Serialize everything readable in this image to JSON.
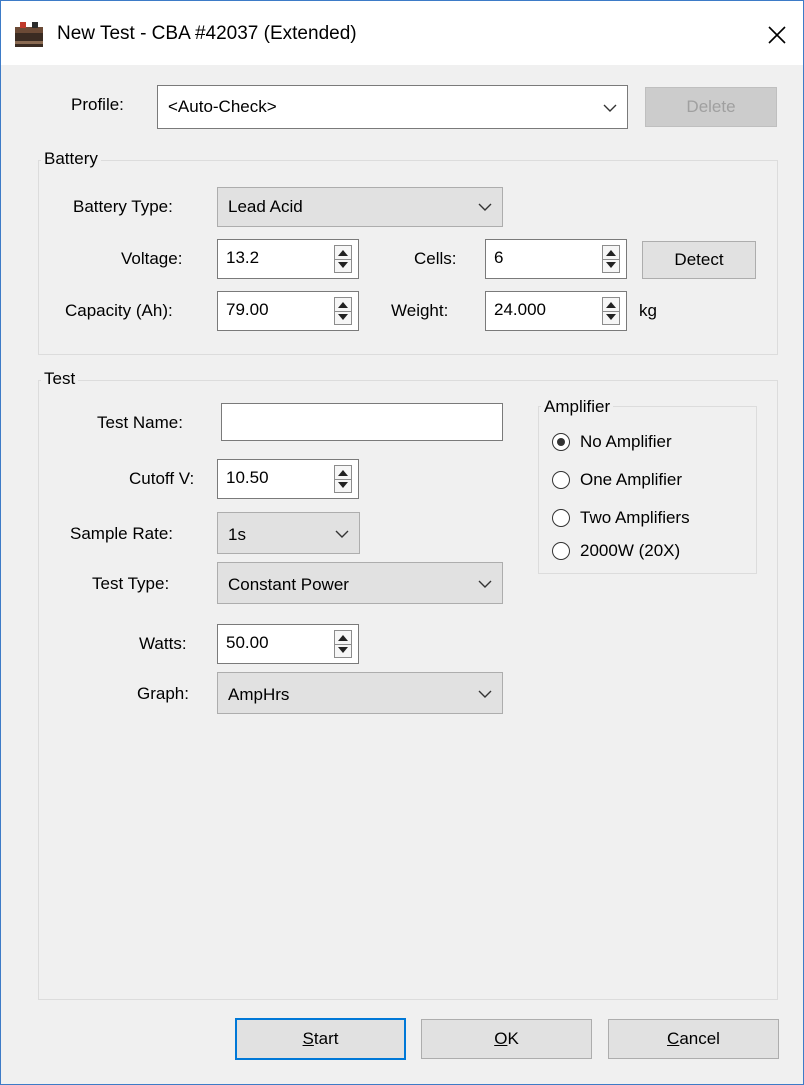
{
  "window": {
    "title": "New Test - CBA #42037 (Extended)"
  },
  "profile": {
    "label": "Profile:",
    "value": "<Auto-Check>",
    "delete_label": "Delete"
  },
  "battery": {
    "group_label": "Battery",
    "type_label": "Battery Type:",
    "type_value": "Lead Acid",
    "voltage_label": "Voltage:",
    "voltage_value": "13.2",
    "cells_label": "Cells:",
    "cells_value": "6",
    "detect_label": "Detect",
    "capacity_label": "Capacity (Ah):",
    "capacity_value": "79.00",
    "weight_label": "Weight:",
    "weight_value": "24.000",
    "weight_unit": "kg"
  },
  "test": {
    "group_label": "Test",
    "name_label": "Test Name:",
    "name_value": "",
    "cutoff_label": "Cutoff V:",
    "cutoff_value": "10.50",
    "sample_rate_label": "Sample Rate:",
    "sample_rate_value": "1s",
    "test_type_label": "Test Type:",
    "test_type_value": "Constant Power",
    "watts_label": "Watts:",
    "watts_value": "50.00",
    "graph_label": "Graph:",
    "graph_value": "AmpHrs"
  },
  "amplifier": {
    "group_label": "Amplifier",
    "options": [
      {
        "label": "No Amplifier",
        "selected": true
      },
      {
        "label": "One Amplifier",
        "selected": false
      },
      {
        "label": "Two Amplifiers",
        "selected": false
      },
      {
        "label": "2000W (20X)",
        "selected": false
      }
    ]
  },
  "buttons": {
    "start_mnemonic": "S",
    "start_rest": "tart",
    "ok_mnemonic": "O",
    "ok_rest": "K",
    "cancel_mnemonic": "C",
    "cancel_rest": "ancel"
  },
  "colors": {
    "accent": "#0078d7",
    "window_border": "#3d7bc7",
    "background": "#f0f0f0"
  }
}
